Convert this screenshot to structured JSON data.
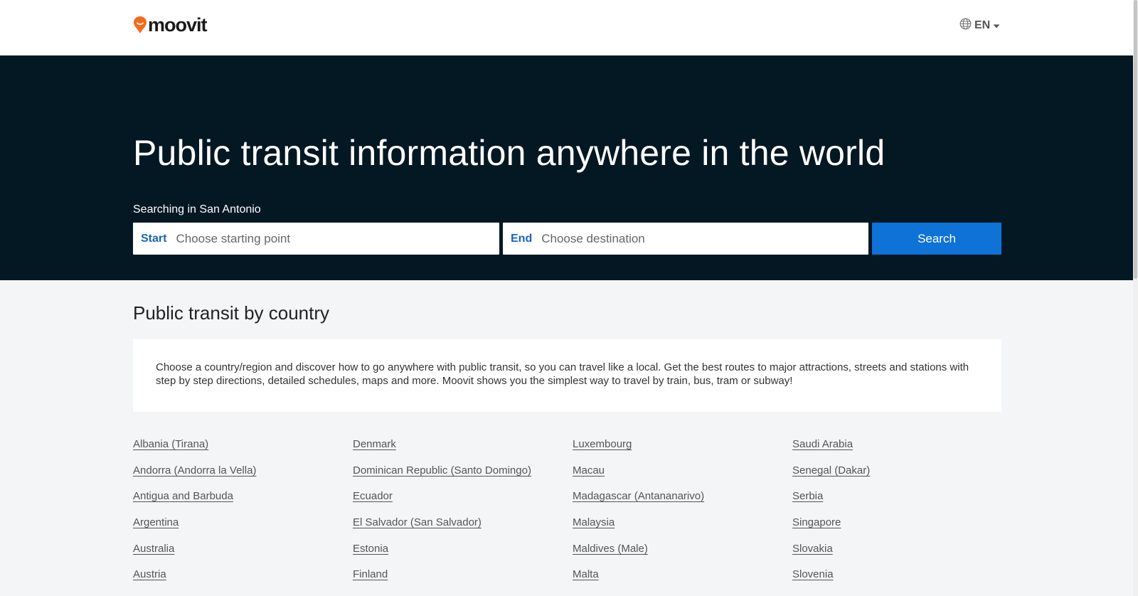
{
  "header": {
    "logo_text": "moovit",
    "language": "EN"
  },
  "hero": {
    "title": "Public transit information anywhere in the world",
    "searching_label": "Searching in San Antonio",
    "start_label": "Start",
    "start_placeholder": "Choose starting point",
    "end_label": "End",
    "end_placeholder": "Choose destination",
    "search_button": "Search"
  },
  "section": {
    "title": "Public transit by country",
    "intro": "Choose a country/region and discover how to go anywhere with public transit, so you can travel like a local. Get the best routes to major attractions, streets and stations with step by step directions, detailed schedules, maps and more. Moovit shows you the simplest way to travel by train, bus, tram or subway!"
  },
  "countries": {
    "col1": [
      "Albania (Tirana)",
      "Andorra (Andorra la Vella)",
      "Antigua and Barbuda",
      "Argentina",
      "Australia",
      "Austria"
    ],
    "col2": [
      "Denmark",
      "Dominican Republic (Santo Domingo)",
      "Ecuador",
      "El Salvador (San Salvador)",
      "Estonia",
      "Finland"
    ],
    "col3": [
      "Luxembourg",
      "Macau",
      "Madagascar (Antananarivo)",
      "Malaysia",
      "Maldives (Male)",
      "Malta"
    ],
    "col4": [
      "Saudi Arabia",
      "Senegal (Dakar)",
      "Serbia",
      "Singapore",
      "Slovakia",
      "Slovenia"
    ]
  },
  "colors": {
    "hero_bg": "#041824",
    "accent_blue": "#0f72d6",
    "label_blue": "#1565c0",
    "logo_orange": "#f26b1d",
    "page_bg": "#f3f5f7"
  },
  "icons": {
    "logo": "moovit-pin-icon",
    "language": "globe-icon",
    "dropdown": "caret-down-icon"
  }
}
